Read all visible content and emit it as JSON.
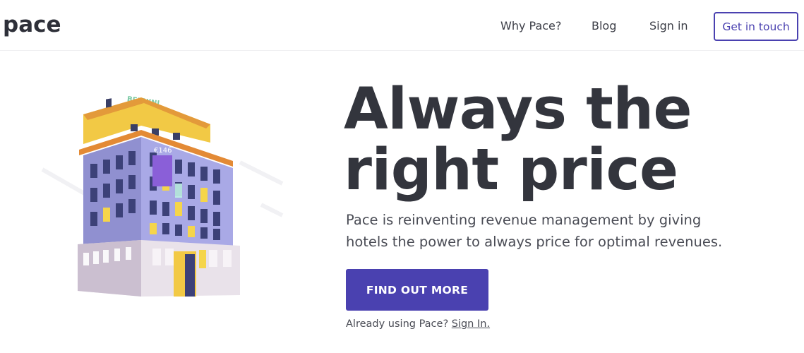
{
  "header": {
    "logo": "pace",
    "nav": [
      {
        "label": "Why Pace?"
      },
      {
        "label": "Blog"
      },
      {
        "label": "Sign in"
      }
    ],
    "cta_label": "Get in touch"
  },
  "hero": {
    "headline_line1": "Always the",
    "headline_line2": "right price",
    "subtext": "Pace is reinventing revenue management by giving hotels the power to always price for optimal revenues.",
    "button_label": "FIND OUT MORE",
    "signin_prompt": "Already using Pace?",
    "signin_link": "Sign In.",
    "illustration": {
      "sign_text": "BERNINI",
      "plaque_text": "€146"
    }
  },
  "colors": {
    "brand": "#4a41b0",
    "text_dark": "#33353d",
    "text_body": "#4a4c55"
  }
}
